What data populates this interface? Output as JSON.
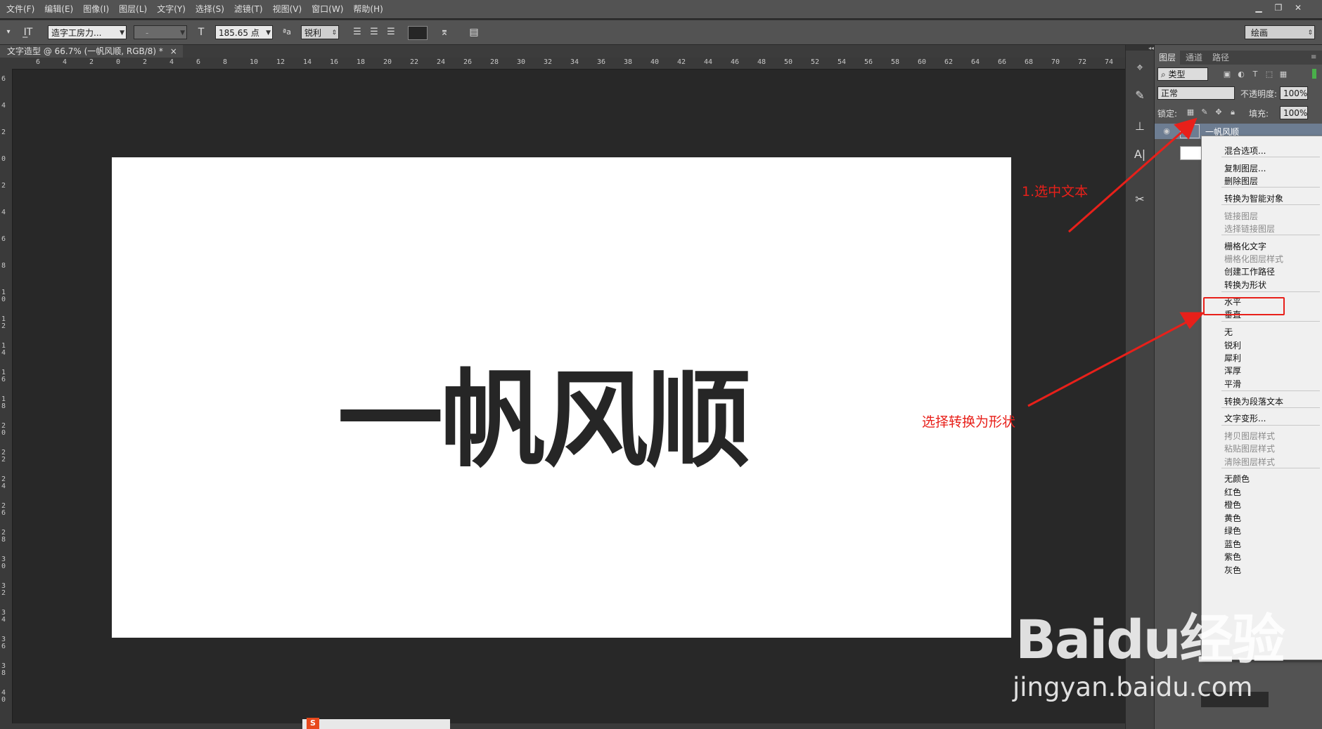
{
  "menubar": {
    "items": [
      "文件(F)",
      "编辑(E)",
      "图像(I)",
      "图层(L)",
      "文字(Y)",
      "选择(S)",
      "滤镜(T)",
      "视图(V)",
      "窗口(W)",
      "帮助(H)"
    ],
    "window_controls": [
      "minimize-icon",
      "restore-icon",
      "close-icon"
    ]
  },
  "options": {
    "font_family": "造字工房力...",
    "font_style": "-",
    "font_size": "185.65 点",
    "aa_label": "ªa",
    "antialias": "锐利",
    "workspace": "绘画"
  },
  "document": {
    "tab_title": "文字造型 @ 66.7% (一帆风顺, RGB/8) *",
    "tab_close": "×"
  },
  "rulers": {
    "h_ticks": [
      "6",
      "4",
      "2",
      "0",
      "2",
      "4",
      "6",
      "8",
      "10",
      "12",
      "14",
      "16",
      "18",
      "20",
      "22",
      "24",
      "26",
      "28",
      "30",
      "32",
      "34",
      "36",
      "38",
      "40",
      "42",
      "44",
      "46",
      "48",
      "50",
      "52",
      "54",
      "56",
      "58",
      "60",
      "62",
      "64",
      "66",
      "68",
      "70",
      "72",
      "74"
    ],
    "v_ticks": [
      "6",
      "4",
      "2",
      "0",
      "2",
      "4",
      "6",
      "8",
      "10",
      "12",
      "14",
      "16",
      "18",
      "20",
      "22",
      "24",
      "26",
      "28",
      "30",
      "32",
      "34",
      "36",
      "38",
      "40"
    ]
  },
  "canvas": {
    "text": "一帆风顺"
  },
  "layers_panel": {
    "tabs": [
      "图层",
      "通道",
      "路径"
    ],
    "filter": "类型",
    "blend_mode": "正常",
    "opacity_label": "不透明度:",
    "opacity": "100%",
    "lock_label": "锁定:",
    "fill_label": "填充:",
    "fill": "100%",
    "layer_name": "一帆风顺"
  },
  "context_menu": {
    "items": [
      {
        "label": "混合选项...",
        "disabled": false
      },
      {
        "label": "复制图层...",
        "disabled": false
      },
      {
        "label": "删除图层",
        "disabled": false
      },
      {
        "label": "转换为智能对象",
        "disabled": false
      },
      {
        "label": "链接图层",
        "disabled": true
      },
      {
        "label": "选择链接图层",
        "disabled": true
      },
      {
        "label": "栅格化文字",
        "disabled": false
      },
      {
        "label": "栅格化图层样式",
        "disabled": true
      },
      {
        "label": "创建工作路径",
        "disabled": false
      },
      {
        "label": "转换为形状",
        "disabled": false
      },
      {
        "label": "水平",
        "disabled": false
      },
      {
        "label": "垂直",
        "disabled": false
      },
      {
        "label": "无",
        "disabled": false
      },
      {
        "label": "锐利",
        "disabled": false
      },
      {
        "label": "犀利",
        "disabled": false
      },
      {
        "label": "浑厚",
        "disabled": false
      },
      {
        "label": "平滑",
        "disabled": false
      },
      {
        "label": "转换为段落文本",
        "disabled": false
      },
      {
        "label": "文字变形...",
        "disabled": false
      },
      {
        "label": "拷贝图层样式",
        "disabled": true
      },
      {
        "label": "粘贴图层样式",
        "disabled": true
      },
      {
        "label": "清除图层样式",
        "disabled": true
      },
      {
        "label": "无颜色",
        "disabled": false
      },
      {
        "label": "红色",
        "disabled": false
      },
      {
        "label": "橙色",
        "disabled": false
      },
      {
        "label": "黄色",
        "disabled": false
      },
      {
        "label": "绿色",
        "disabled": false
      },
      {
        "label": "蓝色",
        "disabled": false
      },
      {
        "label": "紫色",
        "disabled": false
      },
      {
        "label": "灰色",
        "disabled": false
      }
    ]
  },
  "annotations": {
    "step1": "1.选中文本",
    "step2": "选择转换为形状",
    "color": "#e8201a"
  },
  "watermark": {
    "logo": "Baidu经验",
    "url": "jingyan.baidu.com"
  },
  "colors": {
    "ui_bg": "#535353",
    "canvas_bg": "#282828",
    "layer_selected": "#6d7d92",
    "text_color": "#262626"
  }
}
